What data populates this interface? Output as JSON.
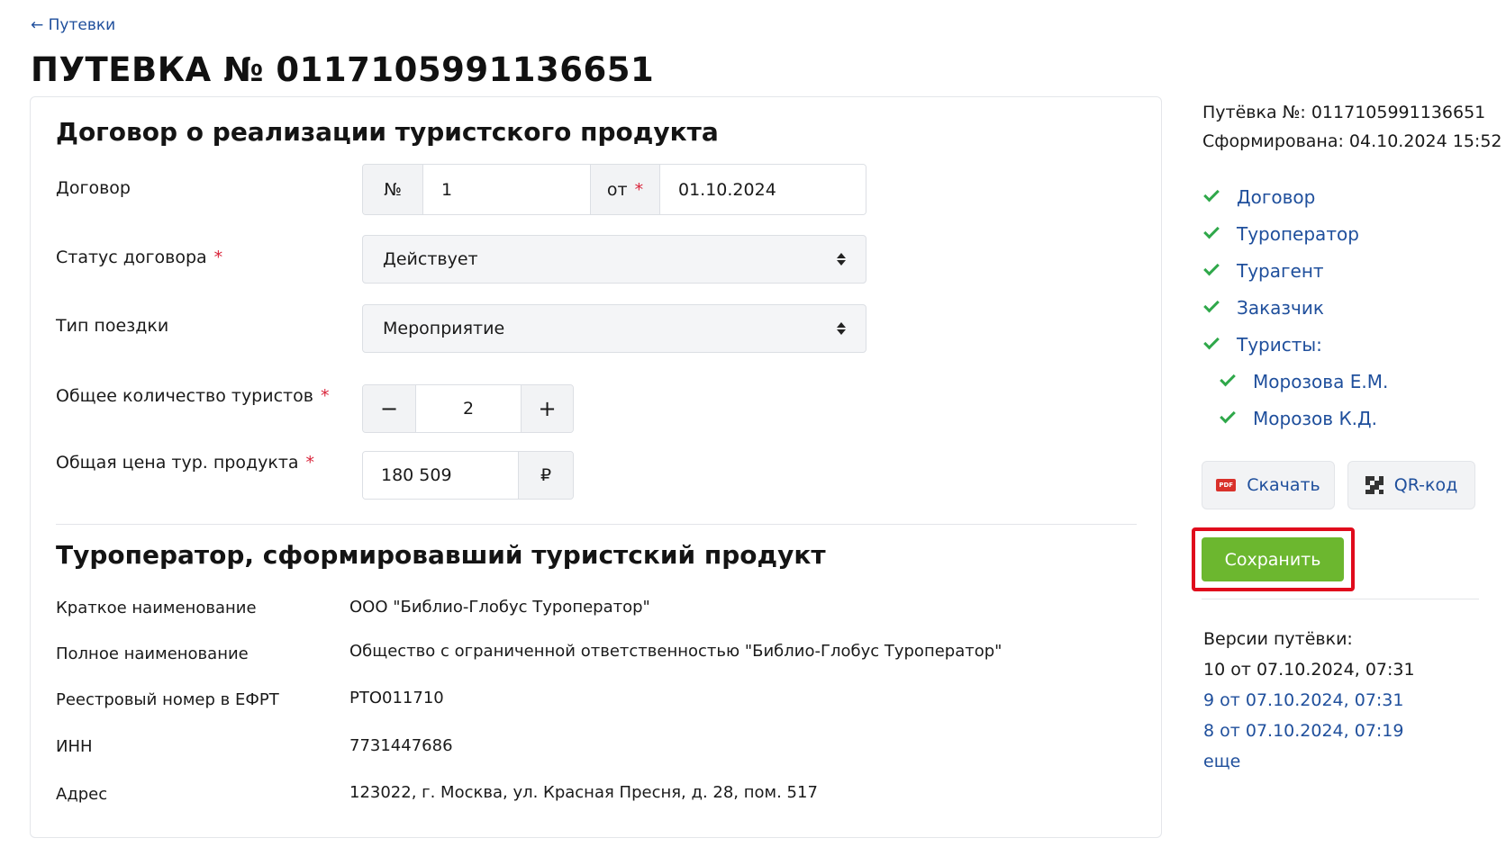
{
  "nav": {
    "back_label": "← Путевки"
  },
  "page": {
    "title": "ПУТЕВКА № 0117105991136651"
  },
  "contract_section": {
    "title": "Договор о реализации туристского продукта",
    "contract": {
      "label": "Договор",
      "number_prefix": "№",
      "number_value": "1",
      "date_prefix": "от",
      "date_required": "*",
      "date_value": "01.10.2024"
    },
    "status": {
      "label": "Статус договора",
      "required": "*",
      "value": "Действует"
    },
    "trip_type": {
      "label": "Тип поездки",
      "value": "Мероприятие"
    },
    "tourists_count": {
      "label": "Общее количество туристов",
      "required": "*",
      "minus": "−",
      "value": "2",
      "plus": "+"
    },
    "price": {
      "label": "Общая цена тур. продукта",
      "required": "*",
      "value": "180 509",
      "currency": "₽"
    }
  },
  "operator_section": {
    "title": "Туроператор, сформировавший туристский продукт",
    "rows": [
      {
        "label": "Краткое наименование",
        "value": "ООО \"Библио-Глобус Туроператор\""
      },
      {
        "label": "Полное наименование",
        "value": "Общество с ограниченной ответственностью \"Библио-Глобус Туроператор\""
      },
      {
        "label": "Реестровый номер в ЕФРТ",
        "value": "РТО011710"
      },
      {
        "label": "ИНН",
        "value": "7731447686"
      },
      {
        "label": "Адрес",
        "value": "123022, г. Москва, ул. Красная Пресня, д. 28, пом. 517"
      }
    ]
  },
  "sidebar": {
    "voucher_line": "Путёвка №: 0117105991136651",
    "formed_line": "Сформирована: 04.10.2024 15:52",
    "nav_items": [
      {
        "label": "Договор"
      },
      {
        "label": "Туроператор"
      },
      {
        "label": "Турагент"
      },
      {
        "label": "Заказчик"
      },
      {
        "label": "Туристы:"
      }
    ],
    "tourists": [
      {
        "label": "Морозова Е.М."
      },
      {
        "label": "Морозов К.Д."
      }
    ],
    "download_label": "Скачать",
    "pdf_badge": "PDF",
    "qr_label": "QR-код",
    "save_label": "Сохранить",
    "versions_title": "Версии путёвки:",
    "versions": [
      {
        "label": "10 от 07.10.2024, 07:31",
        "current": true
      },
      {
        "label": "9 от 07.10.2024, 07:31",
        "current": false
      },
      {
        "label": "8 от 07.10.2024, 07:19",
        "current": false
      }
    ],
    "more_label": "еще"
  },
  "colors": {
    "link": "#1f4f9c",
    "check": "#2fa84a",
    "save_button": "#6cb72f",
    "highlight": "#e00b1c",
    "required": "#d9243a"
  }
}
